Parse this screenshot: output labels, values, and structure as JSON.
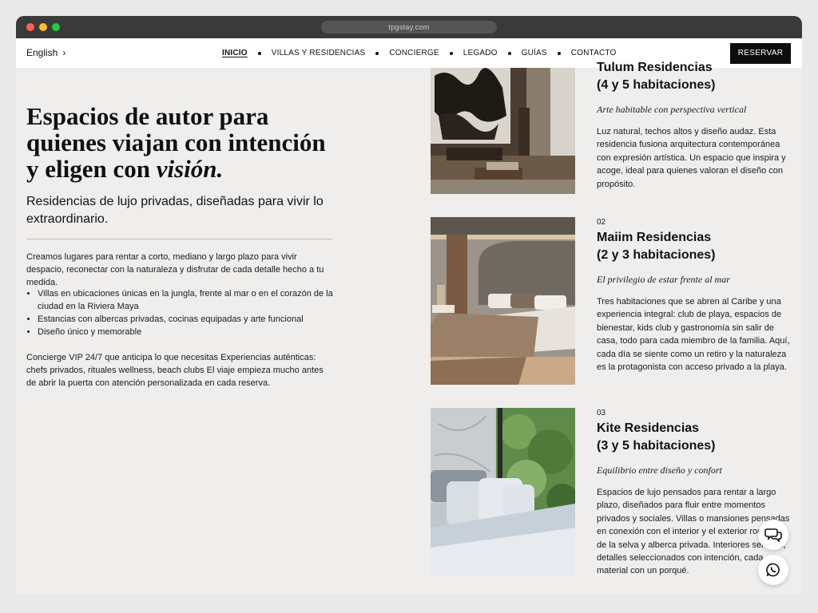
{
  "browser": {
    "url": "tpgstay.com"
  },
  "nav": {
    "language": "English",
    "items": [
      {
        "label": "INICIO"
      },
      {
        "label": "VILLAS Y RESIDENCIAS"
      },
      {
        "label": "CONCIERGE"
      },
      {
        "label": "LEGADO"
      },
      {
        "label": "GUÍAS"
      },
      {
        "label": "CONTACTO"
      }
    ],
    "reserve_label": "RESERVAR"
  },
  "hero": {
    "title_line1": "Espacios de autor para",
    "title_line2": "quienes viajan con intención",
    "title_line3_prefix": "y eligen con ",
    "title_emphasis": "visión.",
    "subtitle": "Residencias de lujo privadas, diseñadas para vivir lo extraordinario.",
    "intro": "Creamos lugares para rentar a corto, mediano y largo plazo para vivir despacio, reconectar con la naturaleza y disfrutar de cada detalle hecho a tu medida.",
    "bullets": [
      "Villas en ubicaciones únicas en la jungla, frente al mar o en el corazón de la ciudad en la Riviera Maya",
      "Estancias con albercas privadas, cocinas equipadas y arte funcional",
      "Diseño único y memorable"
    ],
    "closing": "Concierge VIP 24/7 que anticipa lo que necesitas Experiencias auténticas: chefs privados, rituales wellness, beach clubs El viaje empieza mucho antes de abrir la puerta con atención personalizada en cada reserva."
  },
  "listings": [
    {
      "number": "",
      "name_line1": "Tulum Residencias",
      "name_line2": "(4 y 5 habitaciones)",
      "tagline": "Arte habitable con perspectiva vertical",
      "description": "Luz natural, techos altos y diseño audaz. Esta residencia fusiona arquitectura contemporánea con expresión artística. Un espacio que inspira y acoge, ideal para quienes valoran el diseño con propósito."
    },
    {
      "number": "02",
      "name_line1": "Maiim Residencias",
      "name_line2": "(2 y 3 habitaciones)",
      "tagline": "El privilegio de estar frente al mar",
      "description": "Tres habitaciones que se abren al Caribe y una experiencia integral: club de playa, espacios de bienestar, kids club y gastronomía sin salir de casa, todo para cada miembro de la familia. Aquí, cada día se siente como un retiro y la naturaleza es la protagonista con acceso privado a la playa."
    },
    {
      "number": "03",
      "name_line1": "Kite Residencias",
      "name_line2": "(3 y 5 habitaciones)",
      "tagline": "Equilibrio entre diseño y confort",
      "description": "Espacios de lujo pensados para rentar a largo plazo, diseñados para fluir entre momentos privados y sociales. Villas o mansiones pensadas en conexión con el interior y el exterior rodeados de la selva y alberca privada. Interiores serenos, detalles seleccionados con intención, cada material con un porqué."
    }
  ],
  "icons": {
    "chat": "chat-bubbles-icon",
    "whatsapp": "whatsapp-icon"
  }
}
